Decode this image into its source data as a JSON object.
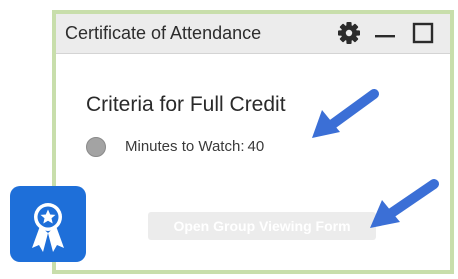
{
  "window": {
    "title": "Certificate of Attendance",
    "controls": {
      "settings_icon": "gear-icon",
      "minimize_icon": "minimize-icon",
      "maximize_icon": "maximize-icon"
    }
  },
  "criteria": {
    "heading": "Criteria for Full Credit",
    "items": [
      {
        "label": "Minutes to Watch:",
        "value": "40",
        "status": "incomplete",
        "status_color": "#a3a3a3"
      }
    ]
  },
  "actions": {
    "group_viewing_label": "Open Group Viewing Form",
    "group_viewing_enabled": false
  },
  "badge": {
    "icon": "award-ribbon-icon",
    "color": "#1e6fd9"
  },
  "annotations": {
    "arrow_color": "#3b6fd6"
  },
  "colors": {
    "panel_border": "#c8deab",
    "titlebar_bg": "#ececec"
  }
}
